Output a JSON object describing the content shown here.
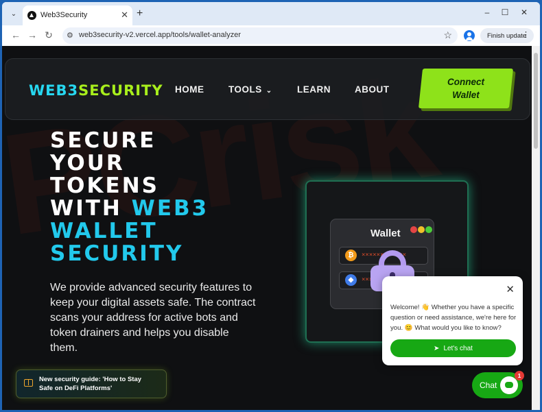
{
  "browser": {
    "tab_title": "Web3Security",
    "new_tab": "+",
    "url": "web3security-v2.vercel.app/tools/wallet-analyzer",
    "finish_update": "Finish update",
    "minimize": "–",
    "maximize": "☐",
    "close": "✕"
  },
  "nav": {
    "logo_part1": "WEB3",
    "logo_part2": "SECURITY",
    "items": [
      {
        "label": "HOME"
      },
      {
        "label": "TOOLS"
      },
      {
        "label": "LEARN"
      },
      {
        "label": "ABOUT"
      }
    ],
    "connect_line1": "Connect",
    "connect_line2": "Wallet"
  },
  "hero": {
    "line1": "SECURE",
    "line2": "YOUR",
    "line3": "TOKENS",
    "line4_white": "WITH ",
    "line4_cyan": "WEB3",
    "line5": "WALLET",
    "line6": "SECURITY",
    "description": "We provide advanced security features to keep your digital assets safe. The contract scans your address for active bots and token drainers and helps you disable them."
  },
  "guide": {
    "text_line1": "New security guide: 'How to Stay",
    "text_line2": "Safe on DeFi Platforms'"
  },
  "illustration": {
    "title": "Wallet",
    "row1_mask": "××××××××××××",
    "row2_mask": "××××××××××××",
    "btc_symbol": "₿",
    "eth_symbol": "◆"
  },
  "chat": {
    "message": "Welcome! 👋 Whether you have a specific question or need assistance, we're here for you. 😊 What would you like to know?",
    "lets_chat": "Let's chat",
    "launcher_label": "Chat",
    "unread_count": "1"
  },
  "colors": {
    "accent_cyan": "#22c9ec",
    "accent_green": "#8ee21a",
    "chat_green": "#17a814"
  }
}
